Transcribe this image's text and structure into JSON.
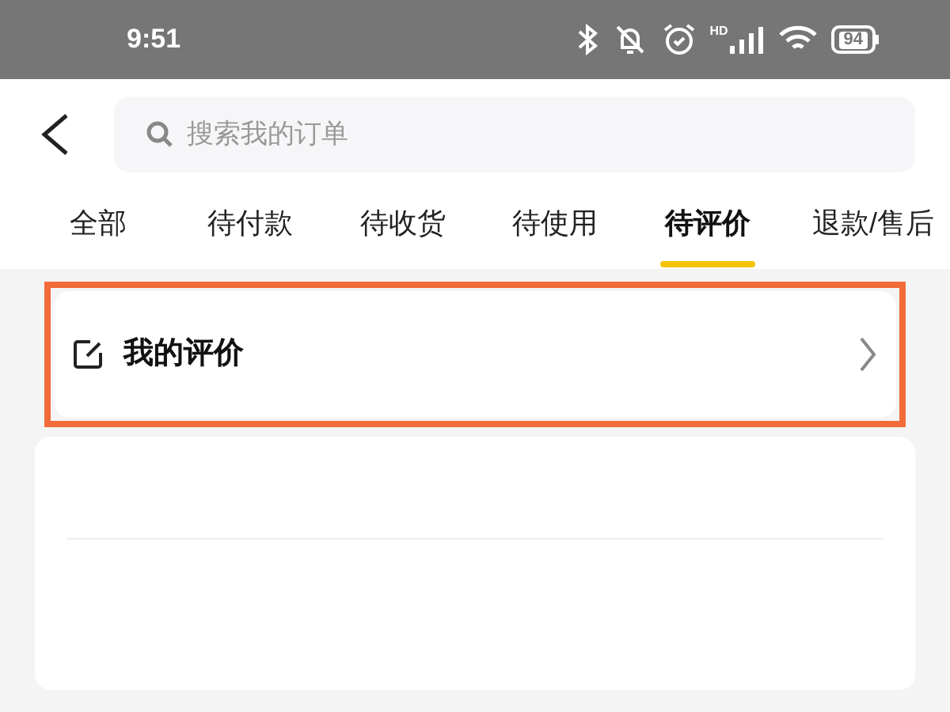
{
  "status_bar": {
    "time": "9:51",
    "network_label": "HD",
    "battery": "94"
  },
  "search": {
    "placeholder": "搜索我的订单"
  },
  "tabs": [
    {
      "label": "全部",
      "selected": false
    },
    {
      "label": "待付款",
      "selected": false
    },
    {
      "label": "待收货",
      "selected": false
    },
    {
      "label": "待使用",
      "selected": false
    },
    {
      "label": "待评价",
      "selected": true
    },
    {
      "label": "退款/售后",
      "selected": false
    }
  ],
  "my_reviews": {
    "label": "我的评价",
    "highlighted": true
  }
}
